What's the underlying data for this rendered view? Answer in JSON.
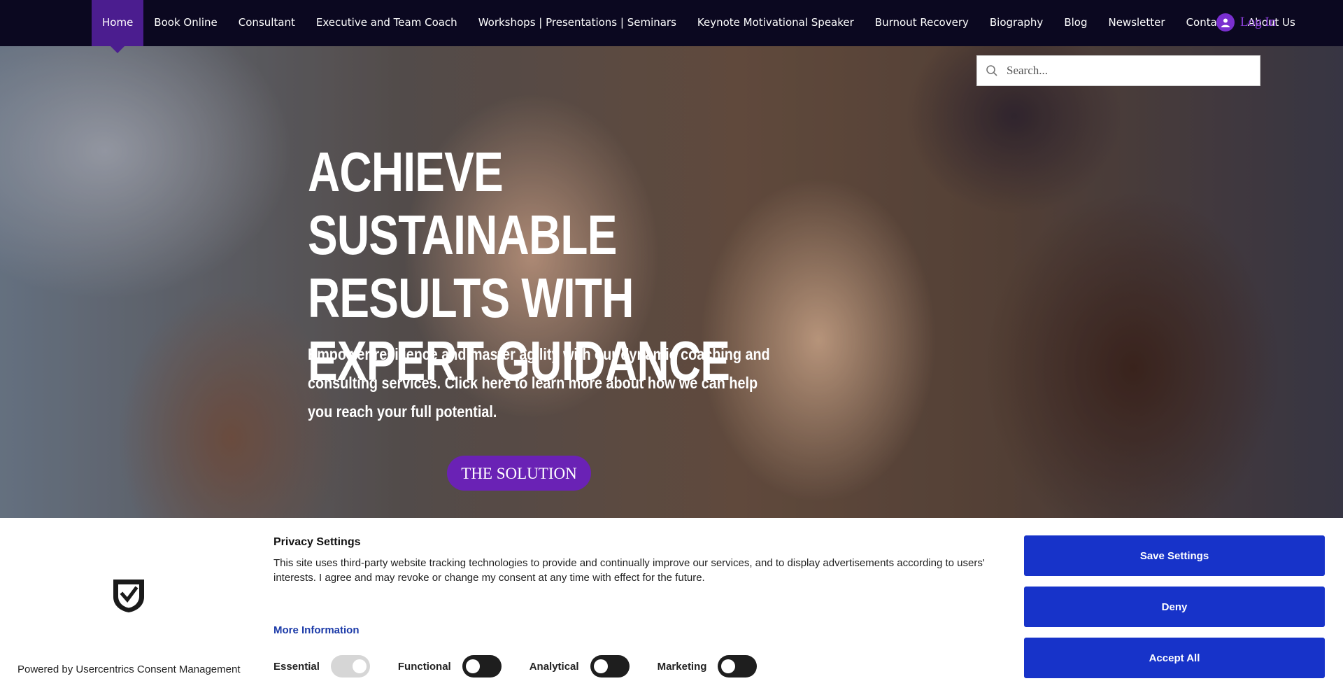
{
  "nav": {
    "items": [
      {
        "label": "Home",
        "active": true
      },
      {
        "label": "Book Online"
      },
      {
        "label": "Consultant"
      },
      {
        "label": "Executive and Team Coach"
      },
      {
        "label": "Workshops | Presentations | Seminars"
      },
      {
        "label": "Keynote Motivational Speaker"
      },
      {
        "label": "Burnout Recovery"
      },
      {
        "label": "Biography"
      },
      {
        "label": "Blog"
      },
      {
        "label": "Newsletter"
      },
      {
        "label": "Contact"
      },
      {
        "label": "About Us"
      }
    ],
    "login_label": "Log In",
    "active_color": "#4b1d8f",
    "login_color": "#8b3fd9"
  },
  "search": {
    "placeholder": "Search..."
  },
  "hero": {
    "title": "ACHIEVE SUSTAINABLE RESULTS WITH EXPERT GUIDANCE",
    "subtitle": "Empower resilience and master agility with our dynamic coaching and consulting services. Click here to learn more about how we can help you reach your full potential.",
    "cta_label": "THE SOLUTION",
    "cta_color": "#6a22b5"
  },
  "consent": {
    "powered_by": "Powered by Usercentrics Consent Management",
    "title": "Privacy Settings",
    "text": "This site uses third-party website tracking technologies to provide and continually improve our services, and to display advertisements according to users' interests. I agree and may revoke or change my consent at any time with effect for the future.",
    "more_info": "More Information",
    "toggles": [
      {
        "label": "Essential",
        "state": "on",
        "disabled": true
      },
      {
        "label": "Functional",
        "state": "off"
      },
      {
        "label": "Analytical",
        "state": "off"
      },
      {
        "label": "Marketing",
        "state": "off"
      }
    ],
    "buttons": {
      "save": "Save Settings",
      "deny": "Deny",
      "accept": "Accept All"
    },
    "button_color": "#1733c9"
  }
}
